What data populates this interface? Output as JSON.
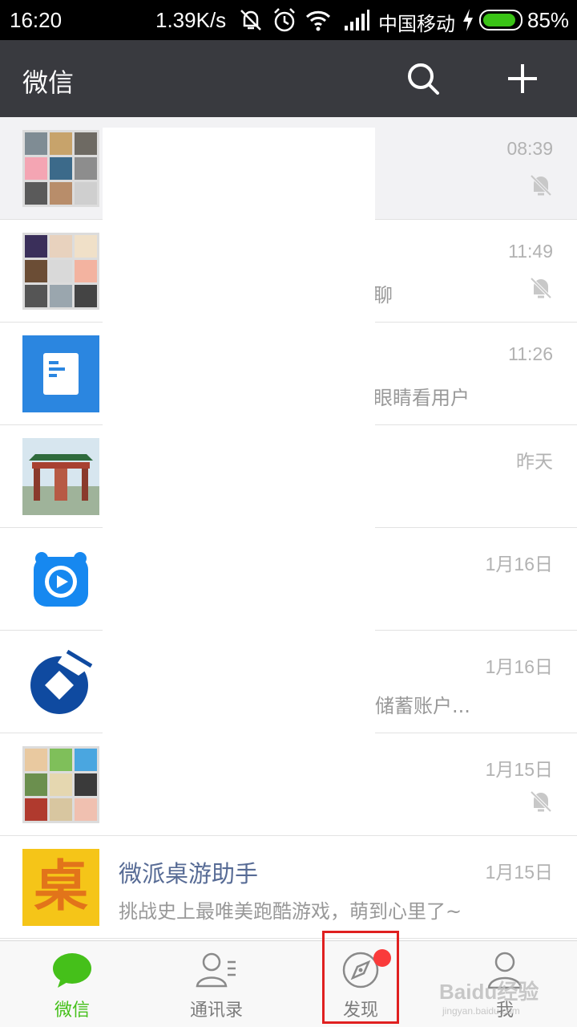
{
  "status_bar": {
    "time": "16:20",
    "network_speed": "1.39K/s",
    "carrier": "中国移动",
    "battery_percent": "85%",
    "battery_level": 0.85,
    "icons": [
      "silent-icon",
      "alarm-icon",
      "wifi-icon",
      "signal-icon",
      "charging-icon",
      "battery-icon"
    ]
  },
  "app_bar": {
    "title": "微信",
    "bg_color": "#393a3f",
    "actions": [
      "search-icon",
      "add-icon"
    ]
  },
  "chats": [
    {
      "name": "",
      "preview": "",
      "time": "08:39",
      "muted": true,
      "pinned": true,
      "avatar": "group-grid"
    },
    {
      "name": "",
      "preview": "聊",
      "time": "11:49",
      "muted": true,
      "avatar": "group-grid"
    },
    {
      "name": "",
      "preview": "眼睛看用户",
      "time": "11:26",
      "muted": false,
      "avatar": "document-icon"
    },
    {
      "name": "",
      "preview": "",
      "time": "昨天",
      "muted": false,
      "avatar": "photo-gate"
    },
    {
      "name": "",
      "preview": "",
      "time": "1月16日",
      "muted": false,
      "avatar": "video-player-icon"
    },
    {
      "name": "",
      "preview": "储蓄账户...",
      "time": "1月16日",
      "muted": false,
      "avatar": "bank-logo"
    },
    {
      "name": "",
      "preview": "",
      "time": "1月15日",
      "muted": true,
      "avatar": "group-grid"
    },
    {
      "name": "微派桌游助手",
      "preview": "挑战史上最唯美跑酷游戏，萌到心里了~",
      "time": "1月15日",
      "muted": false,
      "avatar": "zhuo-logo"
    }
  ],
  "zhuo_char": "桌",
  "tabs": [
    {
      "label": "微信",
      "icon": "chat-bubble-icon",
      "active": true
    },
    {
      "label": "通讯录",
      "icon": "contacts-icon",
      "active": false
    },
    {
      "label": "发现",
      "icon": "compass-icon",
      "active": false,
      "badge_dot": true,
      "highlighted": true
    },
    {
      "label": "我",
      "icon": "me-icon",
      "active": false
    }
  ],
  "watermark": {
    "brand": "Baidu经验",
    "url": "jingyan.baidu.com"
  },
  "colors": {
    "accent_green": "#45c01a",
    "name_blue": "#576b95",
    "highlight_red": "#e02020",
    "badge_red": "#fa3b3b"
  }
}
